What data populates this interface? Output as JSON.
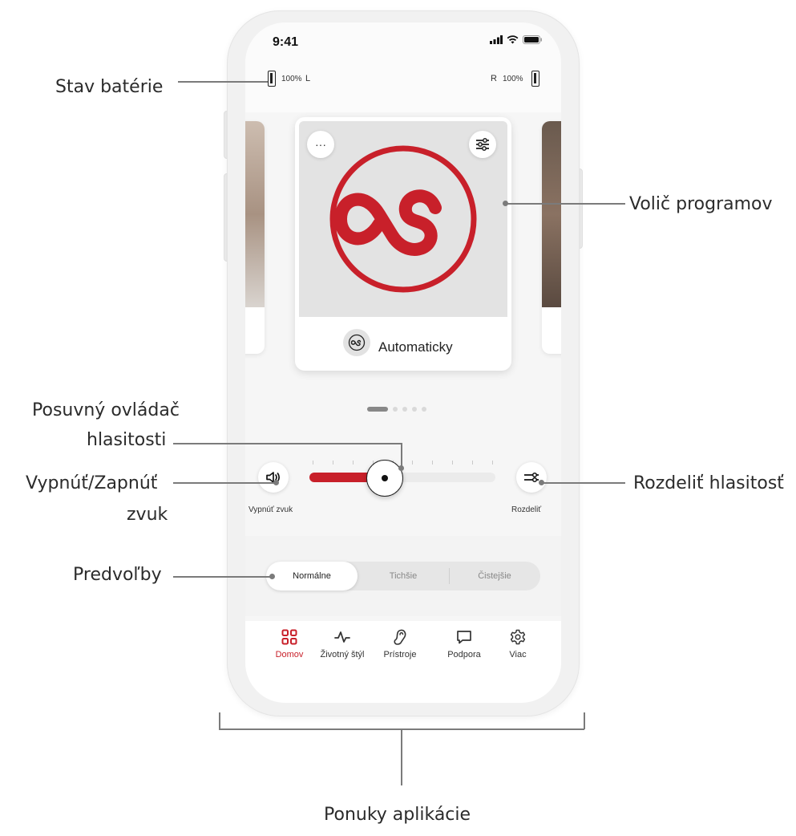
{
  "callouts": {
    "battery": "Stav batérie",
    "program": "Volič programov",
    "volume_slider_line1": "Posuvný ovládač",
    "volume_slider_line2": "hlasitosti",
    "mute_line1": "Vypnúť/Zapnúť",
    "mute_line2": "zvuk",
    "split": "Rozdeliť hlasitosť",
    "presets": "Predvoľby",
    "menus": "Ponuky aplikácie"
  },
  "statusbar": {
    "time": "9:41"
  },
  "battery": {
    "left_value": "100%",
    "left_side": "L",
    "right_side": "R",
    "right_value": "100%"
  },
  "program_card": {
    "more_label": "···",
    "label": "Automaticky",
    "brand_color": "#c8202a"
  },
  "carousel": {
    "pages": 5,
    "active": 0
  },
  "volume": {
    "level": 0.5,
    "mute_label": "Vypnúť zvuk",
    "split_label": "Rozdeliť"
  },
  "presets": {
    "items": [
      "Normálne",
      "Tichšie",
      "Čistejšie"
    ],
    "active": 0
  },
  "nav": {
    "items": [
      {
        "label": "Domov",
        "icon": "grid-icon",
        "active": true
      },
      {
        "label": "Životný štýl",
        "icon": "activity-icon",
        "active": false
      },
      {
        "label": "Prístroje",
        "icon": "hearing-aid-icon",
        "active": false
      },
      {
        "label": "Podpora",
        "icon": "chat-bubble-icon",
        "active": false
      },
      {
        "label": "Viac",
        "icon": "gear-icon",
        "active": false
      }
    ]
  }
}
